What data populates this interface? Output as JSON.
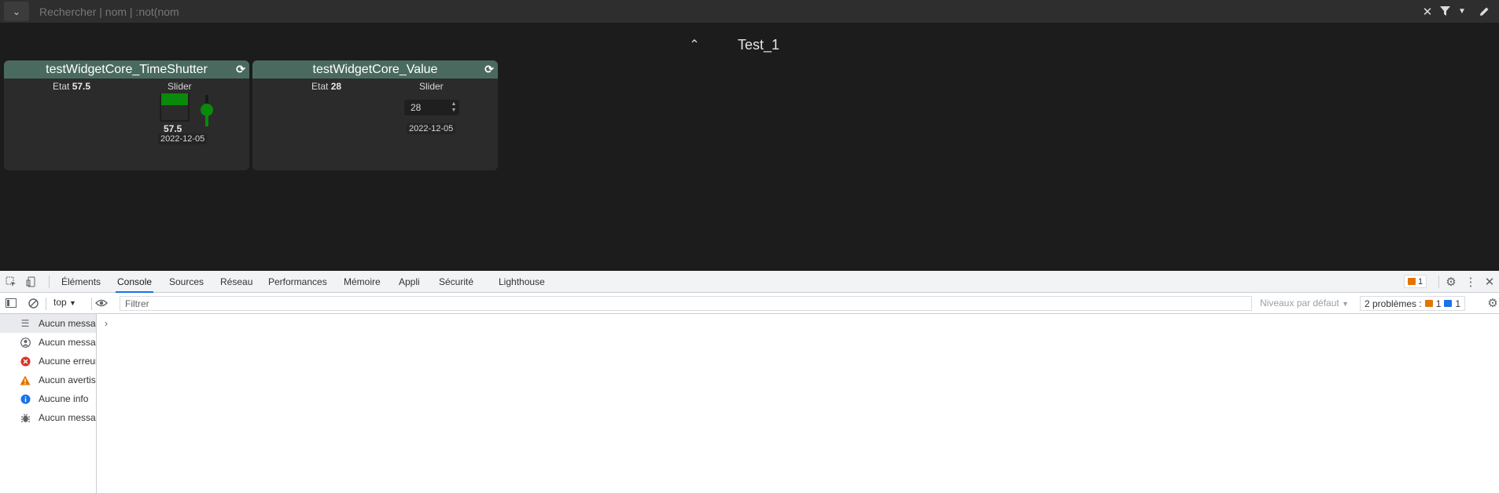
{
  "search": {
    "placeholder": "Rechercher | nom | :not(nom"
  },
  "group": {
    "title": "Test_1"
  },
  "widgets": [
    {
      "title": "testWidgetCore_TimeShutter",
      "state_label": "Etat",
      "state_value": "57.5",
      "slider_label": "Slider",
      "shutter_value": "57.5",
      "date": "2022-12-05"
    },
    {
      "title": "testWidgetCore_Value",
      "state_label": "Etat",
      "state_value": "28",
      "slider_label": "Slider",
      "input_value": "28",
      "date": "2022-12-05"
    }
  ],
  "devtools": {
    "tabs": [
      "Éléments",
      "Console",
      "Sources",
      "Réseau",
      "Performances",
      "Mémoire",
      "Appli",
      "Sécurité",
      "Lighthouse"
    ],
    "active_tab": "Console",
    "issues_count": "1",
    "context": "top",
    "filter_placeholder": "Filtrer",
    "levels": "Niveaux par défaut",
    "problems_label": "2 problèmes :",
    "problems_warn": "1",
    "problems_info": "1",
    "sidebar": [
      {
        "label": "Aucun message",
        "icon": "list-icon",
        "color": "#5f6368"
      },
      {
        "label": "Aucun message utilisateur",
        "icon": "user-icon",
        "color": "#5f6368"
      },
      {
        "label": "Aucune erreur",
        "icon": "error-icon",
        "color": "#d93025"
      },
      {
        "label": "Aucun avertissement",
        "icon": "warning-icon",
        "color": "#e37400"
      },
      {
        "label": "Aucune info",
        "icon": "info-icon",
        "color": "#1a73e8"
      },
      {
        "label": "Aucun message détaillé",
        "icon": "bug-icon",
        "color": "#5f6368"
      }
    ]
  },
  "colors": {
    "accent_green": "#0a8a0a",
    "widget_header": "#4a6a60",
    "devtools_active": "#1a73e8"
  }
}
